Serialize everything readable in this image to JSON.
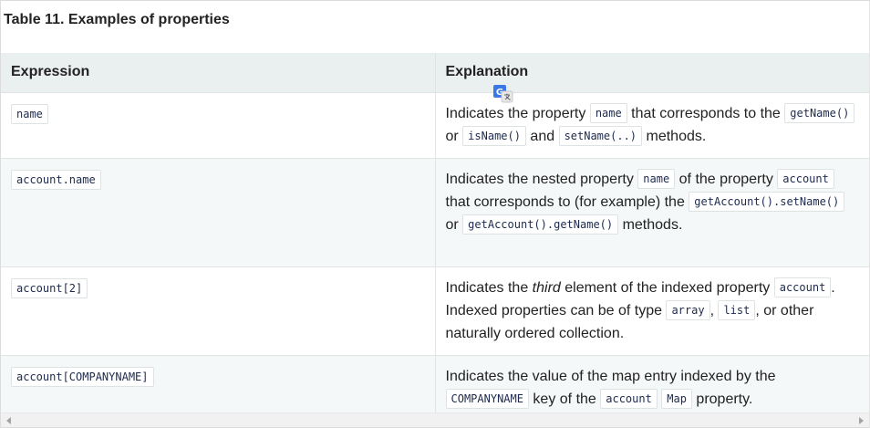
{
  "caption": "Table 11. Examples of properties",
  "headers": {
    "expression": "Expression",
    "explanation": "Explanation"
  },
  "rows": [
    {
      "expression": "name",
      "explanation": {
        "t1": "Indicates the property ",
        "c1": "name",
        "t2": " that corresponds to the ",
        "c2": "getName()",
        "t3": " or ",
        "c3": "isName()",
        "t4": " and ",
        "c4": "setName(..)",
        "t5": " methods."
      }
    },
    {
      "expression": "account.name",
      "explanation": {
        "t1": "Indicates the nested property ",
        "c1": "name",
        "t2": " of the property ",
        "c2": "account",
        "t3": " that corresponds to (for example) the ",
        "c3": "getAccount().setName()",
        "t4": " or ",
        "c4": "getAccount().getName()",
        "t5": " methods."
      }
    },
    {
      "expression": "account[2]",
      "explanation": {
        "t1": "Indicates the ",
        "em": "third",
        "t2": " element of the indexed property ",
        "c1": "account",
        "t3": ". Indexed properties can be of type ",
        "c2": "array",
        "t4": ", ",
        "c3": "list",
        "t5": ", or other naturally ordered collection."
      }
    },
    {
      "expression": "account[COMPANYNAME]",
      "explanation": {
        "t1": "Indicates the value of the map entry indexed by the ",
        "c1": "COMPANYNAME",
        "t2": " key of the ",
        "c2": "account",
        "t3": " ",
        "c3": "Map",
        "t4": " property."
      }
    }
  ],
  "colors": {
    "header_bg": "#eaf0ef",
    "alt_row_bg": "#f5f8f8",
    "code_text": "#1d2a4d",
    "translate_icon": "#3b78e7"
  },
  "icons": {
    "translate": "google-translate-icon"
  }
}
